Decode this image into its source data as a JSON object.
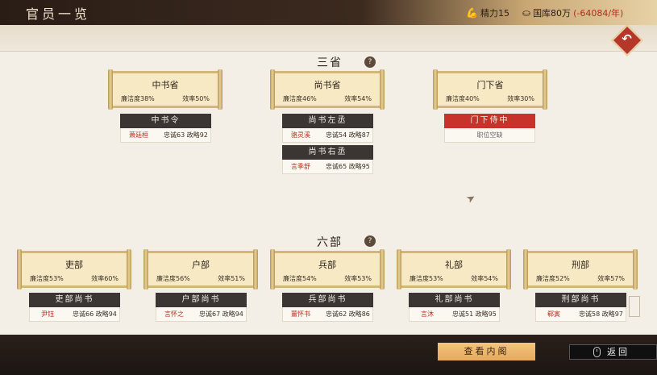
{
  "header": {
    "title": "官员一览",
    "stamina": "精力15",
    "treasury": "国库80万",
    "treasury_change": "(-64084/年)"
  },
  "sections": {
    "three_departments": "三省",
    "six_ministries": "六部",
    "help": "?"
  },
  "departments": [
    {
      "name": "中书省",
      "integrity": "廉洁度38%",
      "efficiency": "效率50%"
    },
    {
      "name": "尚书省",
      "integrity": "廉洁度46%",
      "efficiency": "效率54%"
    },
    {
      "name": "门下省",
      "integrity": "廉洁度40%",
      "efficiency": "效率30%"
    }
  ],
  "dept_officials": [
    {
      "title": "中书令",
      "holder": "萧廷桓",
      "attrs": "忠诚63 政略92"
    },
    {
      "title": "尚书左丞",
      "holder": "骆灵溪",
      "attrs": "忠诚54 政略87"
    },
    {
      "title": "尚书右丞",
      "holder": "言季舒",
      "attrs": "忠诚65 政略95"
    },
    {
      "title": "门下侍中",
      "vacant": "职位空缺"
    }
  ],
  "ministries": [
    {
      "name": "吏部",
      "integrity": "廉洁度53%",
      "efficiency": "效率60%"
    },
    {
      "name": "户部",
      "integrity": "廉洁度56%",
      "efficiency": "效率51%"
    },
    {
      "name": "兵部",
      "integrity": "廉洁度54%",
      "efficiency": "效率53%"
    },
    {
      "name": "礼部",
      "integrity": "廉洁度53%",
      "efficiency": "效率54%"
    },
    {
      "name": "刑部",
      "integrity": "廉洁度52%",
      "efficiency": "效率57%"
    }
  ],
  "ministry_officials": [
    {
      "title": "吏部尚书",
      "holder": "尹钰",
      "attrs": "忠诚66 政略94"
    },
    {
      "title": "户部尚书",
      "holder": "言怀之",
      "attrs": "忠诚67 政略94"
    },
    {
      "title": "兵部尚书",
      "holder": "薑怀书",
      "attrs": "忠诚62 政略86"
    },
    {
      "title": "礼部尚书",
      "holder": "言沐",
      "attrs": "忠诚51 政略95"
    },
    {
      "title": "刑部尚书",
      "holder": "郗寅",
      "attrs": "忠诚58 政略97"
    }
  ],
  "footer": {
    "view_cabinet": "查看内阁",
    "return": "返回"
  },
  "icons": {
    "stamina": "bicep-icon",
    "treasury": "ingot-icon",
    "back": "back-arrow-icon",
    "mouse": "mouse-icon"
  },
  "colors": {
    "accent_red": "#c7332a",
    "negative": "#b42c1e",
    "scroll": "#f6e9c4"
  }
}
